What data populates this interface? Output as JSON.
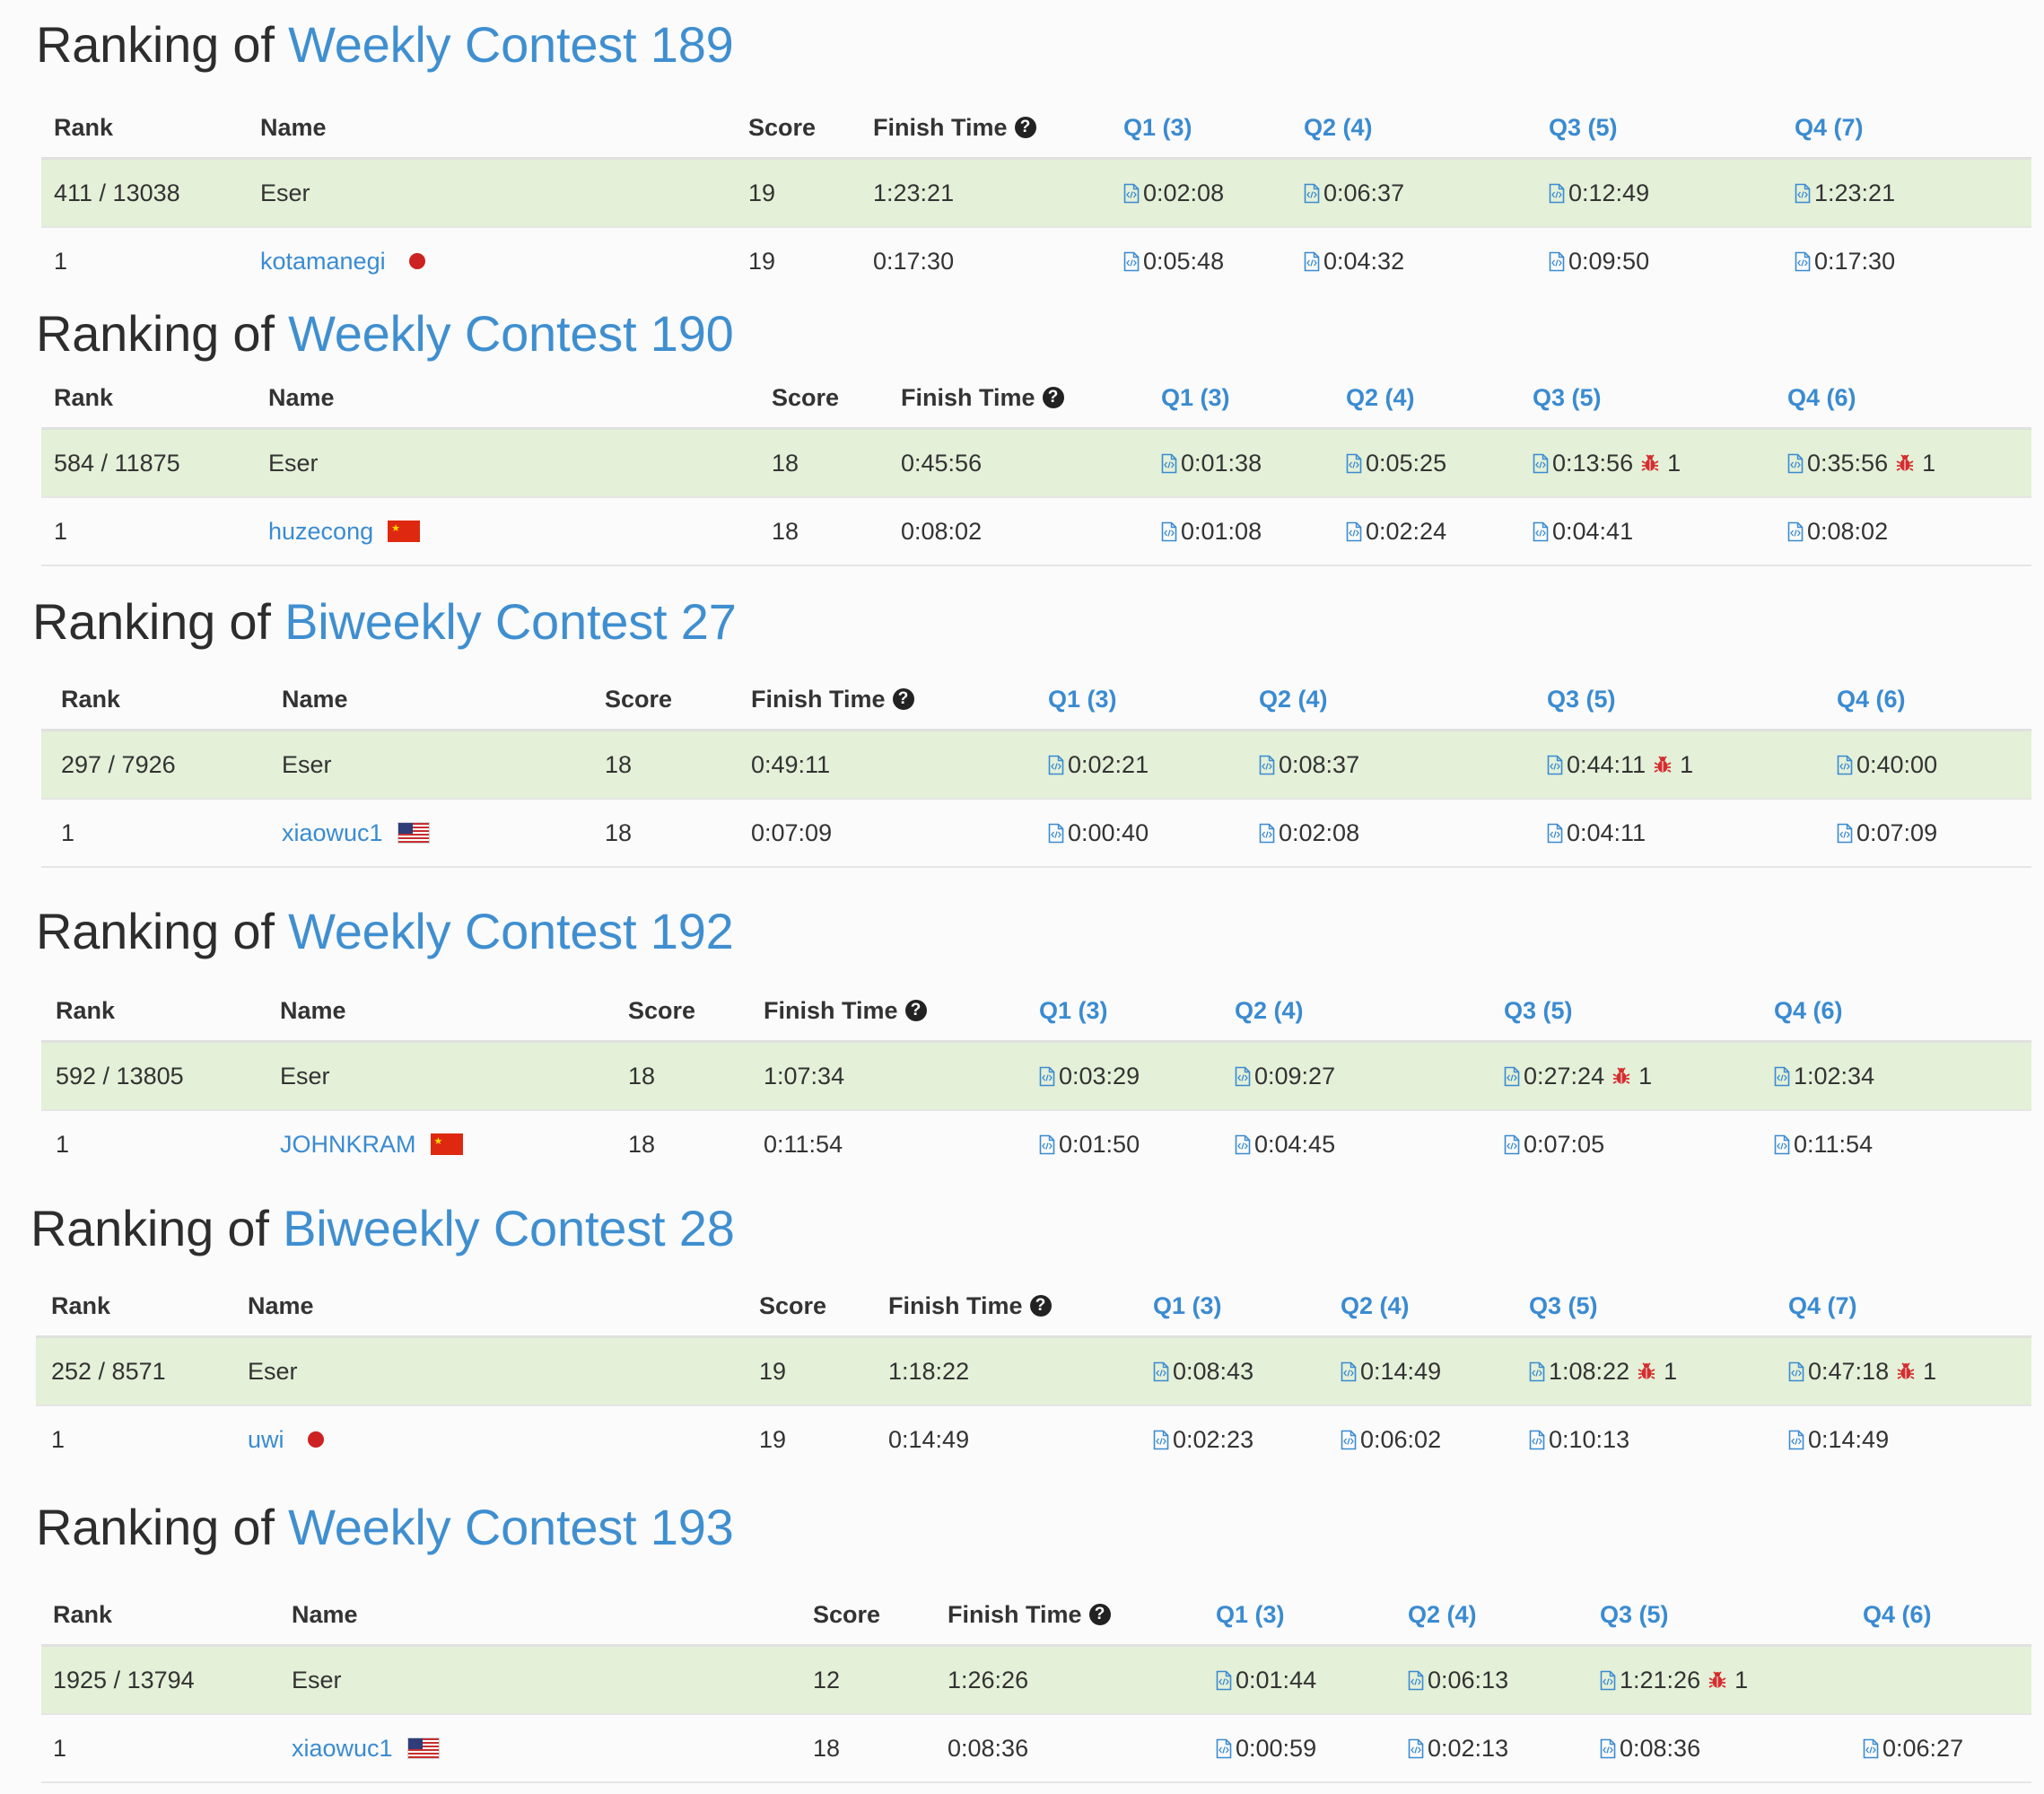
{
  "title_prefix": "Ranking of",
  "finish_time_help_icon": "question-circle-icon",
  "code_icon": "code-file-icon",
  "bug_icon": "bug-icon",
  "colors": {
    "link": "#3a8bd1",
    "self_row_bg": "#e4f0d8",
    "bug": "#d32f2f"
  },
  "contests": [
    {
      "name": "Weekly Contest 189",
      "headers": {
        "rank": "Rank",
        "name": "Name",
        "score": "Score",
        "finish": "Finish Time",
        "q1": "Q1 (3)",
        "q2": "Q2 (4)",
        "q3": "Q3 (5)",
        "q4": "Q4 (7)"
      },
      "rows": [
        {
          "rank": "411 / 13038",
          "name": "Eser",
          "is_link": false,
          "flag": "",
          "score": "19",
          "finish": "1:23:21",
          "q1": {
            "time": "0:02:08",
            "bugs": ""
          },
          "q2": {
            "time": "0:06:37",
            "bugs": ""
          },
          "q3": {
            "time": "0:12:49",
            "bugs": ""
          },
          "q4": {
            "time": "1:23:21",
            "bugs": ""
          }
        },
        {
          "rank": "1",
          "name": "kotamanegi",
          "is_link": true,
          "flag": "jp",
          "score": "19",
          "finish": "0:17:30",
          "q1": {
            "time": "0:05:48",
            "bugs": ""
          },
          "q2": {
            "time": "0:04:32",
            "bugs": ""
          },
          "q3": {
            "time": "0:09:50",
            "bugs": ""
          },
          "q4": {
            "time": "0:17:30",
            "bugs": ""
          }
        }
      ]
    },
    {
      "name": "Weekly Contest 190",
      "headers": {
        "rank": "Rank",
        "name": "Name",
        "score": "Score",
        "finish": "Finish Time",
        "q1": "Q1 (3)",
        "q2": "Q2 (4)",
        "q3": "Q3 (5)",
        "q4": "Q4 (6)"
      },
      "rows": [
        {
          "rank": "584 / 11875",
          "name": "Eser",
          "is_link": false,
          "flag": "",
          "score": "18",
          "finish": "0:45:56",
          "q1": {
            "time": "0:01:38",
            "bugs": ""
          },
          "q2": {
            "time": "0:05:25",
            "bugs": ""
          },
          "q3": {
            "time": "0:13:56",
            "bugs": "1"
          },
          "q4": {
            "time": "0:35:56",
            "bugs": "1"
          }
        },
        {
          "rank": "1",
          "name": "huzecong",
          "is_link": true,
          "flag": "cn",
          "score": "18",
          "finish": "0:08:02",
          "q1": {
            "time": "0:01:08",
            "bugs": ""
          },
          "q2": {
            "time": "0:02:24",
            "bugs": ""
          },
          "q3": {
            "time": "0:04:41",
            "bugs": ""
          },
          "q4": {
            "time": "0:08:02",
            "bugs": ""
          }
        }
      ]
    },
    {
      "name": "Biweekly Contest 27",
      "headers": {
        "rank": "Rank",
        "name": "Name",
        "score": "Score",
        "finish": "Finish Time",
        "q1": "Q1 (3)",
        "q2": "Q2 (4)",
        "q3": "Q3 (5)",
        "q4": "Q4 (6)"
      },
      "rows": [
        {
          "rank": "297 / 7926",
          "name": "Eser",
          "is_link": false,
          "flag": "",
          "score": "18",
          "finish": "0:49:11",
          "q1": {
            "time": "0:02:21",
            "bugs": ""
          },
          "q2": {
            "time": "0:08:37",
            "bugs": ""
          },
          "q3": {
            "time": "0:44:11",
            "bugs": "1"
          },
          "q4": {
            "time": "0:40:00",
            "bugs": ""
          }
        },
        {
          "rank": "1",
          "name": "xiaowuc1",
          "is_link": true,
          "flag": "us",
          "score": "18",
          "finish": "0:07:09",
          "q1": {
            "time": "0:00:40",
            "bugs": ""
          },
          "q2": {
            "time": "0:02:08",
            "bugs": ""
          },
          "q3": {
            "time": "0:04:11",
            "bugs": ""
          },
          "q4": {
            "time": "0:07:09",
            "bugs": ""
          }
        }
      ]
    },
    {
      "name": "Weekly Contest 192",
      "headers": {
        "rank": "Rank",
        "name": "Name",
        "score": "Score",
        "finish": "Finish Time",
        "q1": "Q1 (3)",
        "q2": "Q2 (4)",
        "q3": "Q3 (5)",
        "q4": "Q4 (6)"
      },
      "rows": [
        {
          "rank": "592 / 13805",
          "name": "Eser",
          "is_link": false,
          "flag": "",
          "score": "18",
          "finish": "1:07:34",
          "q1": {
            "time": "0:03:29",
            "bugs": ""
          },
          "q2": {
            "time": "0:09:27",
            "bugs": ""
          },
          "q3": {
            "time": "0:27:24",
            "bugs": "1"
          },
          "q4": {
            "time": "1:02:34",
            "bugs": ""
          }
        },
        {
          "rank": "1",
          "name": "JOHNKRAM",
          "is_link": true,
          "flag": "cn",
          "score": "18",
          "finish": "0:11:54",
          "q1": {
            "time": "0:01:50",
            "bugs": ""
          },
          "q2": {
            "time": "0:04:45",
            "bugs": ""
          },
          "q3": {
            "time": "0:07:05",
            "bugs": ""
          },
          "q4": {
            "time": "0:11:54",
            "bugs": ""
          }
        }
      ]
    },
    {
      "name": "Biweekly Contest 28",
      "headers": {
        "rank": "Rank",
        "name": "Name",
        "score": "Score",
        "finish": "Finish Time",
        "q1": "Q1 (3)",
        "q2": "Q2 (4)",
        "q3": "Q3 (5)",
        "q4": "Q4 (7)"
      },
      "rows": [
        {
          "rank": "252 / 8571",
          "name": "Eser",
          "is_link": false,
          "flag": "",
          "score": "19",
          "finish": "1:18:22",
          "q1": {
            "time": "0:08:43",
            "bugs": ""
          },
          "q2": {
            "time": "0:14:49",
            "bugs": ""
          },
          "q3": {
            "time": "1:08:22",
            "bugs": "1"
          },
          "q4": {
            "time": "0:47:18",
            "bugs": "1"
          }
        },
        {
          "rank": "1",
          "name": "uwi",
          "is_link": true,
          "flag": "jp",
          "score": "19",
          "finish": "0:14:49",
          "q1": {
            "time": "0:02:23",
            "bugs": ""
          },
          "q2": {
            "time": "0:06:02",
            "bugs": ""
          },
          "q3": {
            "time": "0:10:13",
            "bugs": ""
          },
          "q4": {
            "time": "0:14:49",
            "bugs": ""
          }
        }
      ]
    },
    {
      "name": "Weekly Contest 193",
      "headers": {
        "rank": "Rank",
        "name": "Name",
        "score": "Score",
        "finish": "Finish Time",
        "q1": "Q1 (3)",
        "q2": "Q2 (4)",
        "q3": "Q3 (5)",
        "q4": "Q4 (6)"
      },
      "rows": [
        {
          "rank": "1925 / 13794",
          "name": "Eser",
          "is_link": false,
          "flag": "",
          "score": "12",
          "finish": "1:26:26",
          "q1": {
            "time": "0:01:44",
            "bugs": ""
          },
          "q2": {
            "time": "0:06:13",
            "bugs": ""
          },
          "q3": {
            "time": "1:21:26",
            "bugs": "1"
          },
          "q4": {
            "time": "",
            "bugs": ""
          }
        },
        {
          "rank": "1",
          "name": "xiaowuc1",
          "is_link": true,
          "flag": "us",
          "score": "18",
          "finish": "0:08:36",
          "q1": {
            "time": "0:00:59",
            "bugs": ""
          },
          "q2": {
            "time": "0:02:13",
            "bugs": ""
          },
          "q3": {
            "time": "0:08:36",
            "bugs": ""
          },
          "q4": {
            "time": "0:06:27",
            "bugs": ""
          }
        }
      ]
    }
  ]
}
